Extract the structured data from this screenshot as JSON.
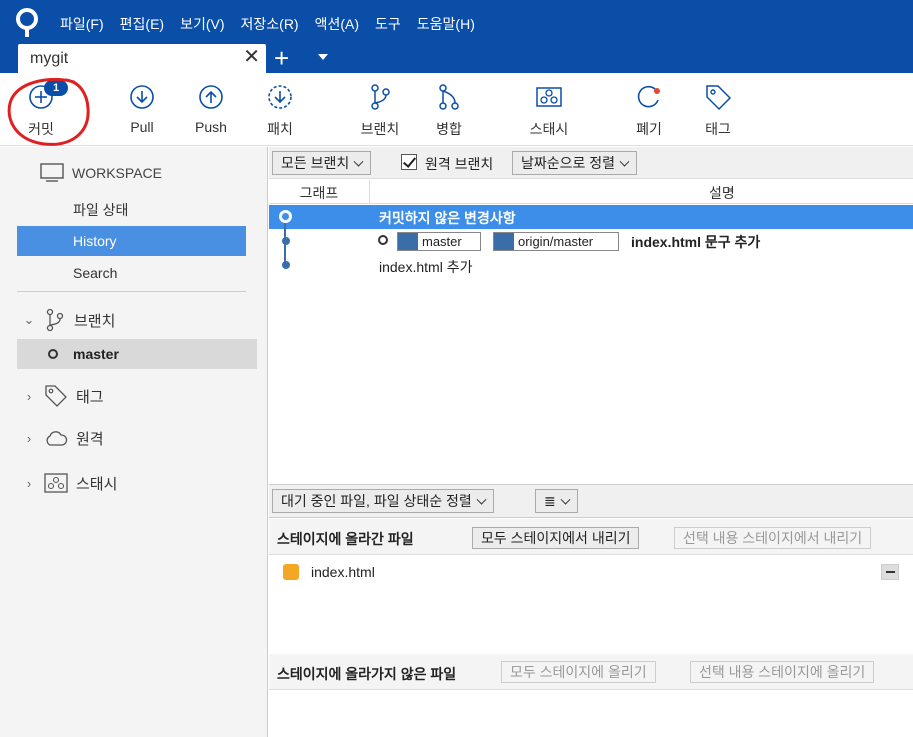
{
  "menu": [
    "파일(F)",
    "편집(E)",
    "보기(V)",
    "저장소(R)",
    "액션(A)",
    "도구",
    "도움말(H)"
  ],
  "tab": {
    "name": "mygit",
    "close": "✕",
    "add": "+"
  },
  "toolbar": {
    "commit": "커밋",
    "commit_badge": "1",
    "pull": "Pull",
    "push": "Push",
    "patch": "패치",
    "branch": "브랜치",
    "merge": "병합",
    "stash": "스태시",
    "discard": "폐기",
    "tag": "태그"
  },
  "sidebar": {
    "workspace": "WORKSPACE",
    "items": [
      "파일 상태",
      "History",
      "Search"
    ],
    "branches": "브랜치",
    "current_branch": "master",
    "tags": "태그",
    "remotes": "원격",
    "stashes": "스태시"
  },
  "filter": {
    "all_branches": "모든 브랜치",
    "remote_branches": "원격 브랜치",
    "sort": "날짜순으로 정렬"
  },
  "columns": {
    "graph": "그래프",
    "description": "설명"
  },
  "commits": [
    {
      "message": "커밋하지 않은 변경사항"
    },
    {
      "tags": [
        "master",
        "origin/master"
      ],
      "message": "index.html 문구 추가"
    },
    {
      "message": "index.html 추가"
    }
  ],
  "staging": {
    "pending_sort": "대기 중인 파일, 파일 상태순 정렬",
    "list_icon": "≣",
    "staged_title": "스테이지에 올라간 파일",
    "unstage_all": "모두 스테이지에서 내리기",
    "unstage_selected": "선택 내용 스테이지에서 내리기",
    "staged_files": [
      "index.html"
    ],
    "unstaged_title": "스테이지에 올라가지 않은 파일",
    "stage_all": "모두 스테이지에 올리기",
    "stage_selected": "선택 내용 스테이지에 올리기"
  },
  "colors": {
    "brand": "#0a4ea8",
    "selection": "#3d8ee8",
    "annotation": "#e02020"
  }
}
